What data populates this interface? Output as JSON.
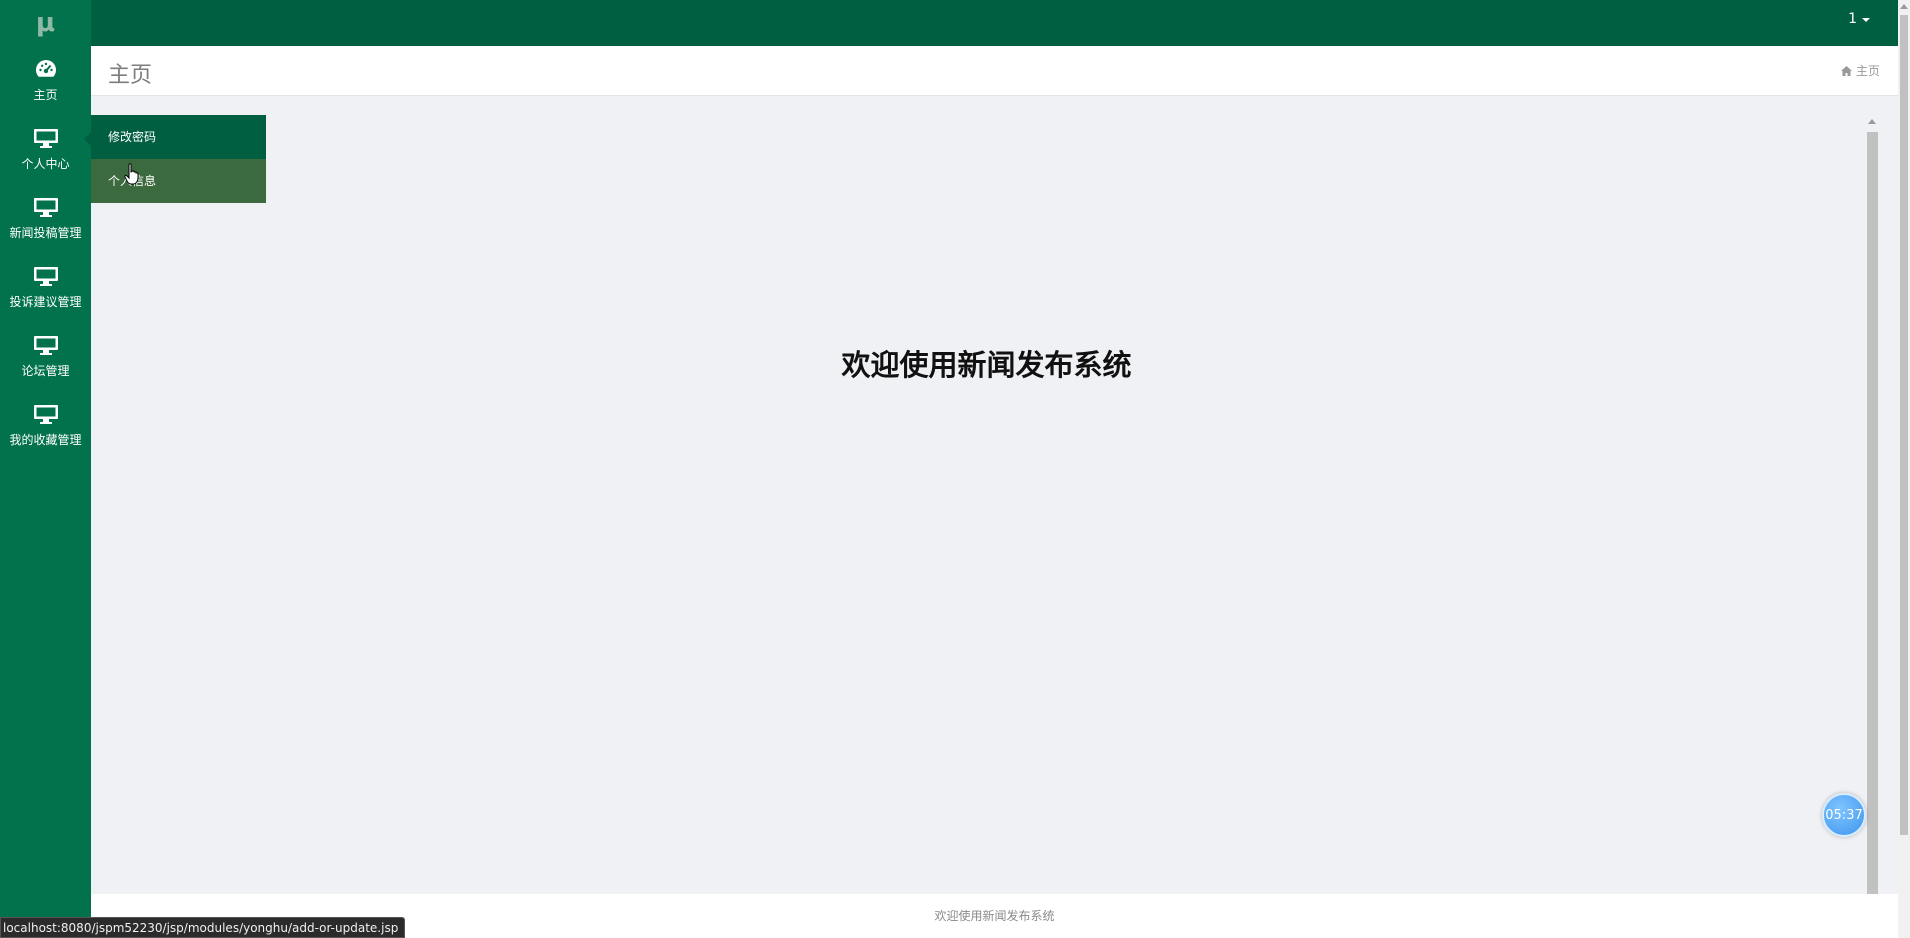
{
  "app": {
    "logo_text": "μ"
  },
  "topbar": {
    "user_label": "1"
  },
  "sidebar": {
    "items": [
      {
        "label": "主页",
        "icon": "dashboard-icon"
      },
      {
        "label": "个人中心",
        "icon": "monitor-icon"
      },
      {
        "label": "新闻投稿管理",
        "icon": "monitor-icon"
      },
      {
        "label": "投诉建议管理",
        "icon": "monitor-icon"
      },
      {
        "label": "论坛管理",
        "icon": "monitor-icon"
      },
      {
        "label": "我的收藏管理",
        "icon": "monitor-icon"
      }
    ]
  },
  "submenu": {
    "items": [
      {
        "label": "修改密码"
      },
      {
        "label": "个人信息"
      }
    ]
  },
  "page": {
    "title": "主页",
    "breadcrumb": "主页",
    "welcome": "欢迎使用新闻发布系统"
  },
  "footer": {
    "text": "欢迎使用新闻发布系统"
  },
  "timer": {
    "value": "05:37"
  },
  "statusbar": {
    "url": "localhost:8080/jspm52230/jsp/modules/yonghu/add-or-update.jsp"
  },
  "colors": {
    "topbar": "#015f41",
    "sidebar": "#02724c",
    "submenu_active": "#015f41",
    "submenu_hover": "#3b6a3e"
  }
}
